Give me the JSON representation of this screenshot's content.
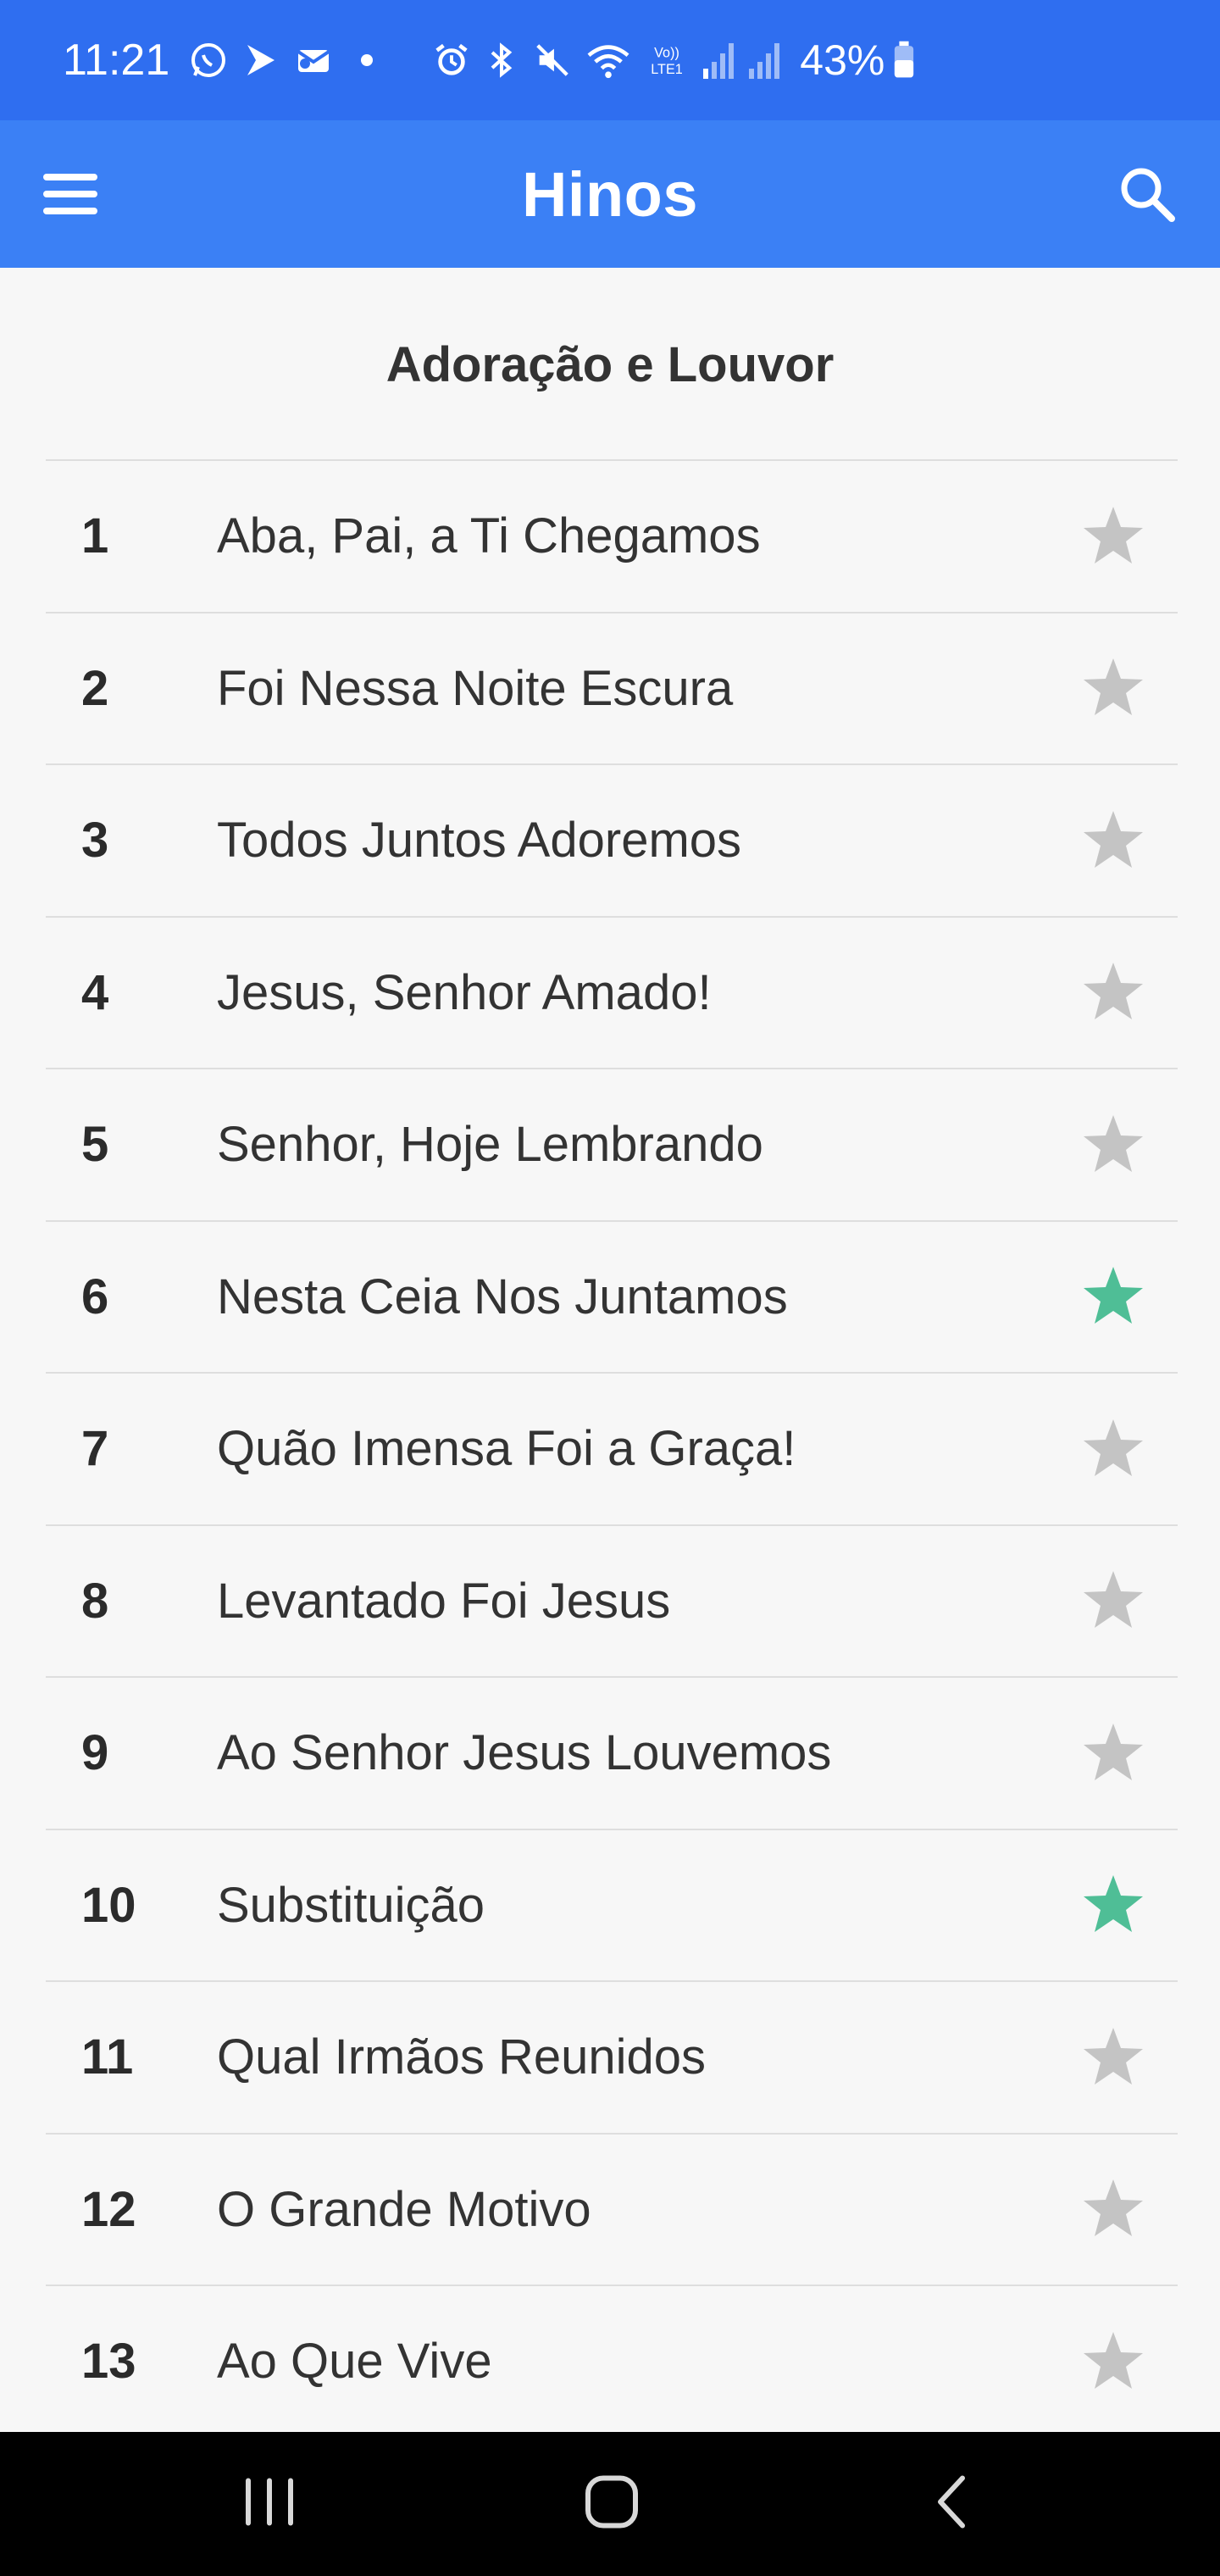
{
  "status_bar": {
    "time": "11:21",
    "battery": "43%",
    "icons": [
      "whatsapp-icon",
      "play-store-icon",
      "outlook-icon",
      "dot-icon",
      "alarm-icon",
      "bluetooth-icon",
      "mute-icon",
      "wifi-icon",
      "volte-icon",
      "signal-icon",
      "signal-icon",
      "battery-icon"
    ],
    "volte_label": "Vo))\nLTE1"
  },
  "app_bar": {
    "title": "Hinos",
    "menu_icon": "hamburger-menu-icon",
    "search_icon": "search-icon"
  },
  "section": {
    "title": "Adoração e Louvor"
  },
  "hymns": [
    {
      "number": "1",
      "title": "Aba, Pai, a Ti Chegamos",
      "favorite": false
    },
    {
      "number": "2",
      "title": "Foi Nessa Noite Escura",
      "favorite": false
    },
    {
      "number": "3",
      "title": "Todos Juntos Adoremos",
      "favorite": false
    },
    {
      "number": "4",
      "title": "Jesus, Senhor Amado!",
      "favorite": false
    },
    {
      "number": "5",
      "title": "Senhor, Hoje Lembrando",
      "favorite": false
    },
    {
      "number": "6",
      "title": "Nesta Ceia Nos Juntamos",
      "favorite": true
    },
    {
      "number": "7",
      "title": "Quão Imensa Foi a Graça!",
      "favorite": false
    },
    {
      "number": "8",
      "title": "Levantado Foi Jesus",
      "favorite": false
    },
    {
      "number": "9",
      "title": "Ao Senhor Jesus Louvemos",
      "favorite": false
    },
    {
      "number": "10",
      "title": "Substituição",
      "favorite": true
    },
    {
      "number": "11",
      "title": "Qual Irmãos Reunidos",
      "favorite": false
    },
    {
      "number": "12",
      "title": "O Grande Motivo",
      "favorite": false
    },
    {
      "number": "13",
      "title": "Ao Que Vive",
      "favorite": false
    }
  ],
  "colors": {
    "status_bar": "#2f6ef0",
    "app_bar": "#3b80f5",
    "star_favorite": "#4fbe96",
    "star_default": "#c4c4c4",
    "background": "#f7f7f7"
  },
  "nav_bar": {
    "buttons": [
      "recent-apps-icon",
      "home-icon",
      "back-icon"
    ]
  }
}
